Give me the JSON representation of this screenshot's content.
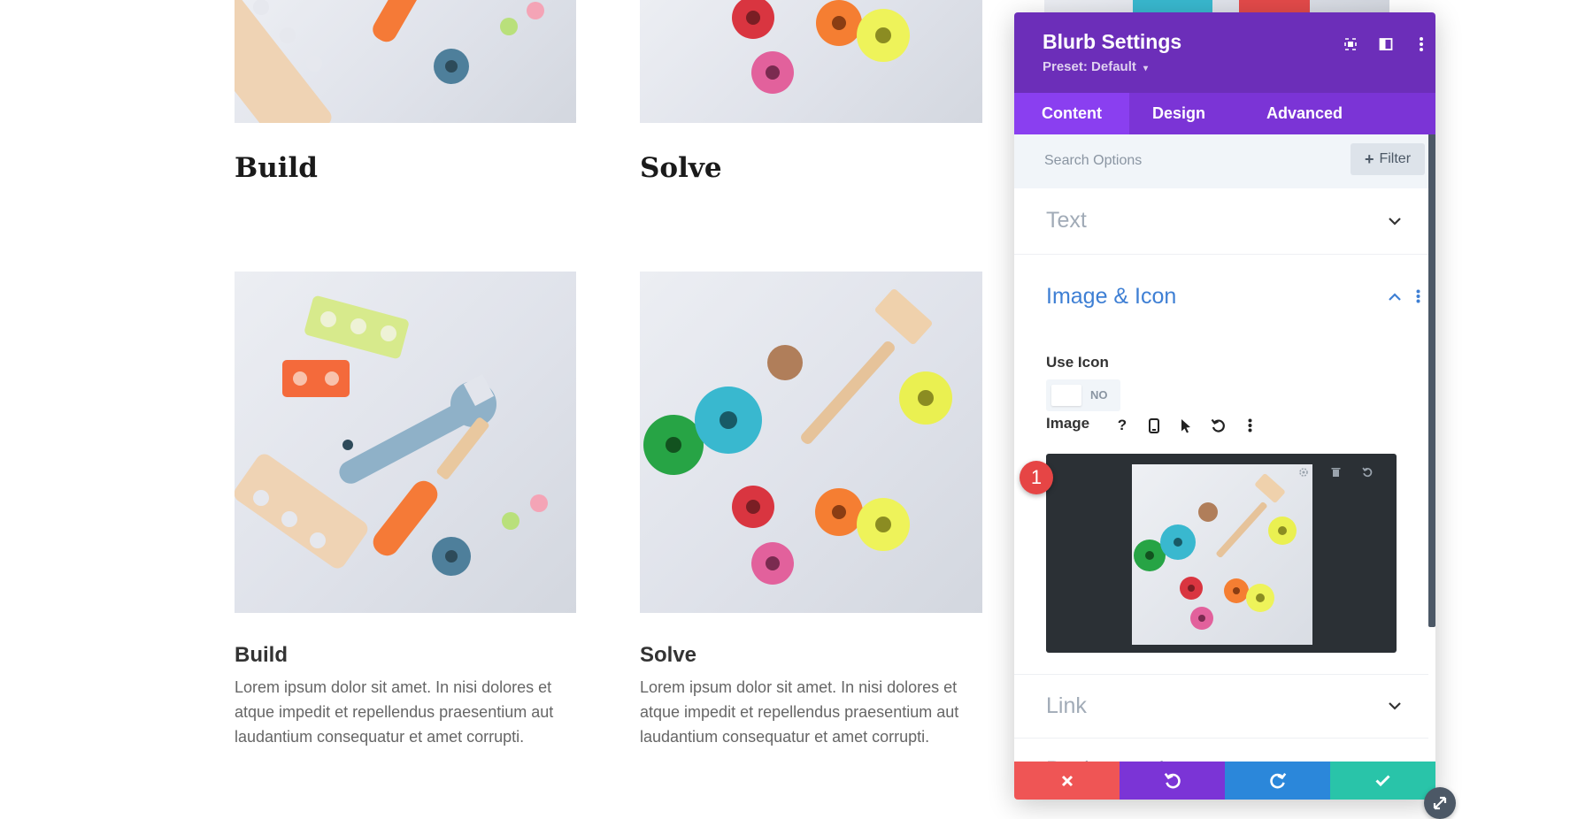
{
  "columns": [
    {
      "heading": "Build",
      "image_alt": "wooden toy tools: wrench, screwdriver, nuts and bolts"
    },
    {
      "heading": "Solve",
      "image_alt": "wooden toy hammer with colorful stacking rings"
    }
  ],
  "blurbs": [
    {
      "title": "Build",
      "text": "Lorem ipsum dolor sit amet. In nisi dolores et atque impedit et repellendus praesentium aut laudantium consequatur et amet corrupti."
    },
    {
      "title": "Solve",
      "text": "Lorem ipsum dolor sit amet. In nisi dolores et atque impedit et repellendus praesentium aut laudantium consequatur et amet corrupti."
    }
  ],
  "panel": {
    "title": "Blurb Settings",
    "preset": "Preset: Default",
    "header_icons": [
      "expand-icon",
      "sidebar-layout-icon",
      "more-vertical-icon"
    ],
    "tabs": [
      {
        "label": "Content",
        "active": true
      },
      {
        "label": "Design",
        "active": false
      },
      {
        "label": "Advanced",
        "active": false
      }
    ],
    "search": {
      "placeholder": "Search Options",
      "value": ""
    },
    "filter_label": "Filter",
    "sections": {
      "text": {
        "title": "Text",
        "expanded": false
      },
      "image_icon": {
        "title": "Image & Icon",
        "expanded": true,
        "use_icon_label": "Use Icon",
        "use_icon_state": "NO",
        "image_label": "Image",
        "image_tool_icons": [
          "help-icon",
          "mobile-icon",
          "cursor-hover-icon",
          "reset-icon",
          "more-vertical-icon"
        ],
        "upload_icons": [
          "gear-icon",
          "trash-icon",
          "reset-icon"
        ],
        "badge_number": "1"
      },
      "link": {
        "title": "Link",
        "expanded": false
      },
      "background": {
        "title": "Background",
        "expanded": false
      }
    },
    "footer": {
      "buttons": [
        {
          "name": "discard",
          "icon": "close-icon",
          "color": "#ef5555"
        },
        {
          "name": "undo",
          "icon": "undo-icon",
          "color": "#7b34d6"
        },
        {
          "name": "redo",
          "icon": "redo-icon",
          "color": "#2b87da"
        },
        {
          "name": "save",
          "icon": "check-icon",
          "color": "#29c4a9"
        }
      ]
    }
  },
  "colors": {
    "header_purple": "#6c2eb9",
    "tab_purple": "#7b34d6",
    "active_tab": "#8a3ff0",
    "section_open_blue": "#3e7fd4",
    "badge_red": "#e64545"
  }
}
